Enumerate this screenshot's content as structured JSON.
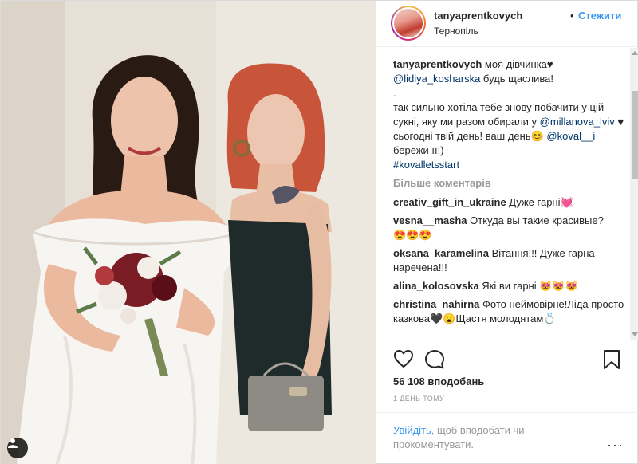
{
  "post": {
    "username": "tanyaprentkovych",
    "separator": "•",
    "follow_label": "Стежити",
    "location": "Тернопіль"
  },
  "caption": {
    "author": "tanyaprentkovych",
    "line1": " моя дівчинка",
    "heart1": "♥",
    "mention1": "@lidiya_kosharska",
    "line2": " будь щаслива!",
    "dot": ".",
    "line3": "так сильно хотіла тебе знову побачити у цій сукні, яку ми разом обирали у ",
    "mention2": "@millanova_lviv",
    "line4": " ♥ сьогодні твій день! ваш день",
    "emoji_smile": "😊",
    "mention3": "@koval__i",
    "line5": " бережи її!)",
    "hashtag": "#kovalletsstart"
  },
  "more_comments_label": "Більше коментарів",
  "comments": [
    {
      "user": "creativ_gift_in_ukraine",
      "text": " Дуже гарні",
      "emoji": "💓"
    },
    {
      "user": "vesna__masha",
      "text": " Откуда вы такие красивые?",
      "emoji": "😍😍😍"
    },
    {
      "user": "oksana_karamelina",
      "text": " Вітання!!! Дуже гарна наречена!!!",
      "emoji": ""
    },
    {
      "user": "alina_kolosovska",
      "text": " Які ви гарні ",
      "emoji": "😻😻😻"
    },
    {
      "user": "christina_nahirna",
      "text": " Фото неймовірне!Ліда просто казкова",
      "emoji": "🖤😮Щастя молодятам💍"
    }
  ],
  "likes": "56 108 вподобань",
  "time": "1 ДЕНЬ ТОМУ",
  "footer": {
    "login_link": "Увійдіть",
    "login_text": ", щоб вподобати чи прокоментувати.",
    "more_symbol": "···"
  },
  "icons": {
    "like": "heart-icon",
    "comment": "comment-icon",
    "save": "bookmark-icon",
    "tag": "user-tag-icon"
  },
  "colors": {
    "link_blue": "#3897f0",
    "mention_blue": "#003569",
    "muted": "#999999"
  }
}
